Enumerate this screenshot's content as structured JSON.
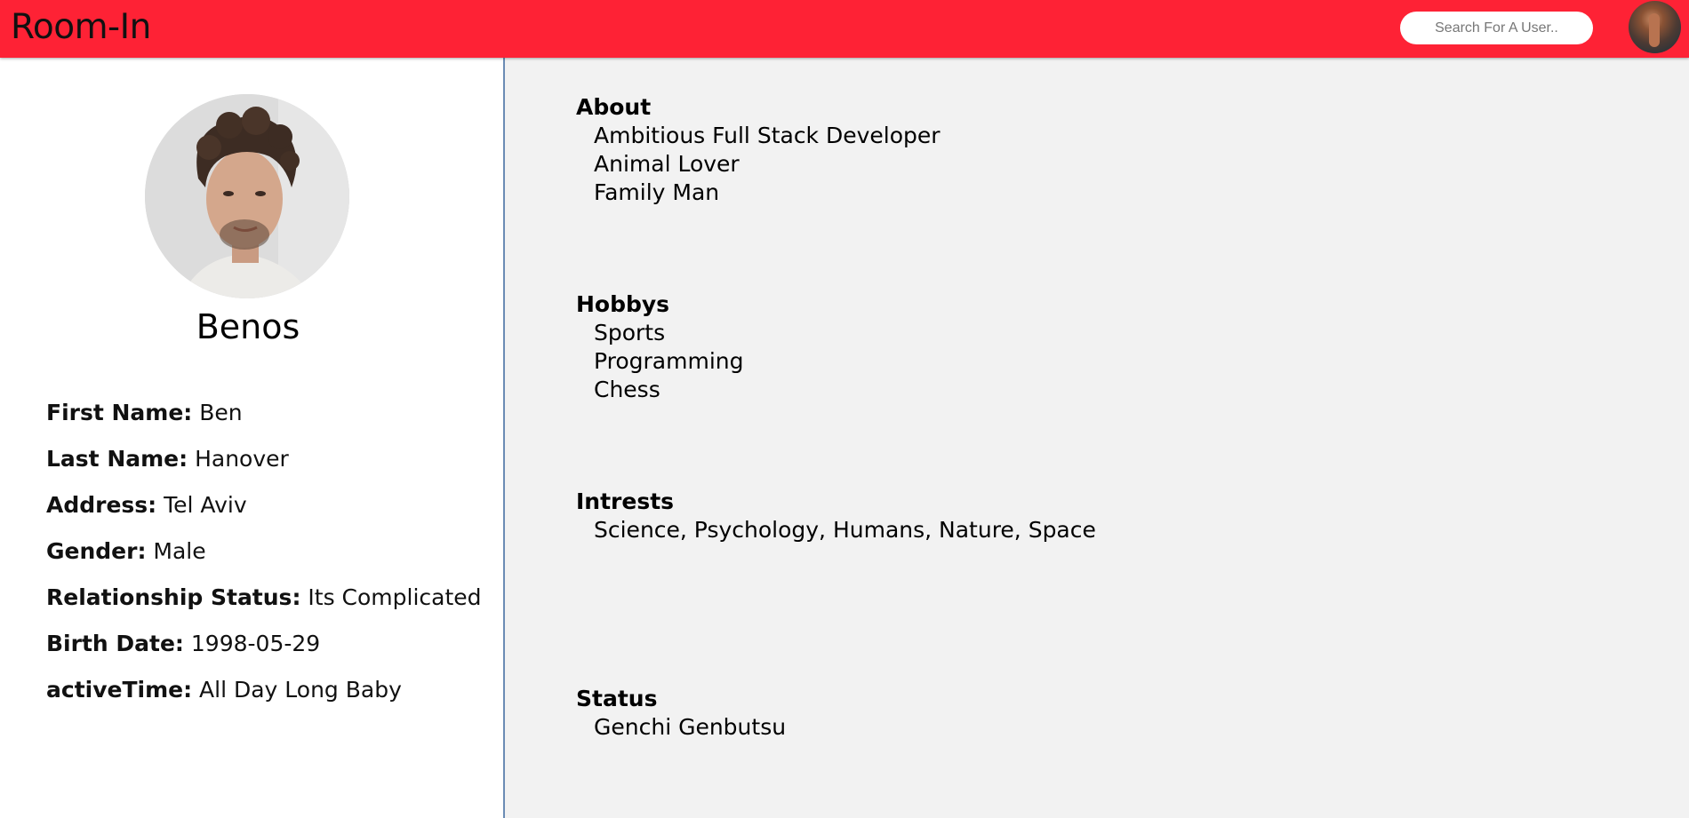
{
  "header": {
    "brand": "Room-In",
    "search_placeholder": "Search For A User.."
  },
  "profile": {
    "name": "Benos",
    "details": [
      {
        "label": "First Name:",
        "value": "Ben"
      },
      {
        "label": "Last Name:",
        "value": "Hanover"
      },
      {
        "label": "Address:",
        "value": "Tel Aviv"
      },
      {
        "label": "Gender:",
        "value": "Male"
      },
      {
        "label": "Relationship Status:",
        "value": "Its Complicated"
      },
      {
        "label": "Birth Date:",
        "value": "1998-05-29"
      },
      {
        "label": "activeTime:",
        "value": "All Day Long Baby"
      }
    ]
  },
  "sections": [
    {
      "title": "About",
      "items": [
        "Ambitious Full Stack Developer",
        "Animal Lover",
        "Family Man"
      ]
    },
    {
      "title": "Hobbys",
      "items": [
        "Sports",
        "Programming",
        "Chess"
      ]
    },
    {
      "title": "Intrests",
      "items": [
        "Science, Psychology, Humans, Nature, Space"
      ]
    },
    {
      "title": "Status",
      "items": [
        "Genchi Genbutsu"
      ]
    }
  ],
  "colors": {
    "header_bg": "#fe2235",
    "main_bg": "#f2f2f2",
    "sidebar_bg": "#ffffff",
    "divider": "#6b8cb5"
  }
}
